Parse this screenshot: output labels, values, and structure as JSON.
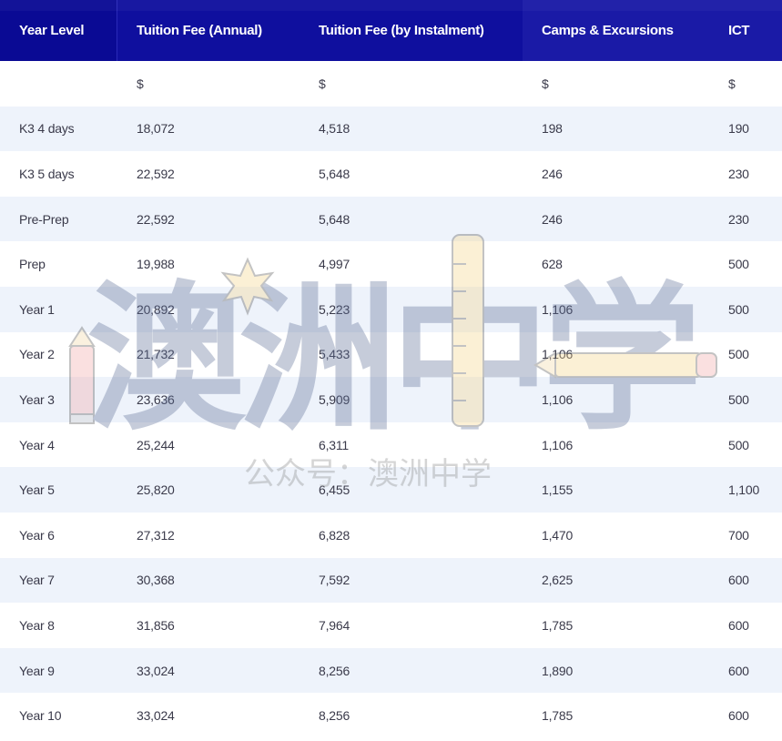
{
  "table": {
    "headers": [
      "Year Level",
      "Tuition Fee (Annual)",
      "Tuition Fee (by Instalment)",
      "Camps & Excursions",
      "ICT"
    ],
    "currency_row": [
      "",
      "$",
      "$",
      "$",
      "$"
    ],
    "rows": [
      [
        "K3 4 days",
        "18,072",
        "4,518",
        "198",
        "190"
      ],
      [
        "K3 5 days",
        "22,592",
        "5,648",
        "246",
        "230"
      ],
      [
        "Pre-Prep",
        "22,592",
        "5,648",
        "246",
        "230"
      ],
      [
        "Prep",
        "19,988",
        "4,997",
        "628",
        "500"
      ],
      [
        "Year 1",
        "20,892",
        "5,223",
        "1,106",
        "500"
      ],
      [
        "Year 2",
        "21,732",
        "5,433",
        "1,106",
        "500"
      ],
      [
        "Year 3",
        "23,636",
        "5,909",
        "1,106",
        "500"
      ],
      [
        "Year 4",
        "25,244",
        "6,311",
        "1,106",
        "500"
      ],
      [
        "Year 5",
        "25,820",
        "6,455",
        "1,155",
        "1,100"
      ],
      [
        "Year 6",
        "27,312",
        "6,828",
        "1,470",
        "700"
      ],
      [
        "Year 7",
        "30,368",
        "7,592",
        "2,625",
        "600"
      ],
      [
        "Year 8",
        "31,856",
        "7,964",
        "1,785",
        "600"
      ],
      [
        "Year 9",
        "33,024",
        "8,256",
        "1,890",
        "600"
      ],
      [
        "Year 10",
        "33,024",
        "8,256",
        "1,785",
        "600"
      ]
    ]
  },
  "watermark": {
    "big_text": "澳洲中学",
    "sub_text": "公众号：澳洲中学",
    "icons": [
      "pencil-icon",
      "star-icon",
      "ruler-icon",
      "pencil-icon"
    ]
  },
  "colors": {
    "header_bg": "#0f0f9e",
    "header_text": "#ffffff",
    "row_alt_bg": "#eef3fb",
    "cell_text": "#3a3a4a"
  }
}
